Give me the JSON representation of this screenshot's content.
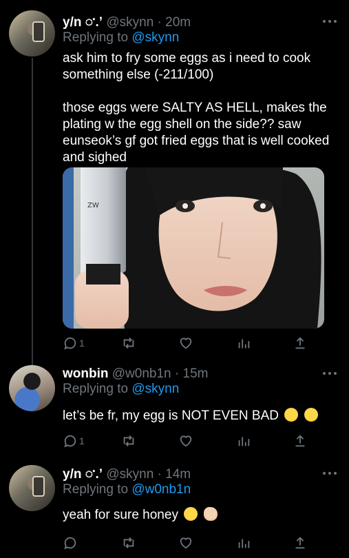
{
  "tweets": [
    {
      "display_name": "y/n 𑀀.’",
      "handle": "@skynn",
      "sep": "·",
      "time": "20m",
      "replying_prefix": "Replying to",
      "replying_to": "@skynn",
      "text_paragraphs": [
        "ask him to fry some eggs as i need to cook something else (-211/100)",
        "those eggs were SALTY AS HELL, makes the plating w the egg shell on the side?? saw eunseok’s gf got fried eggs that is well cooked and sighed"
      ],
      "reply_count": "1"
    },
    {
      "display_name": "wonbin",
      "handle": "@w0nb1n",
      "sep": "·",
      "time": "15m",
      "replying_prefix": "Replying to",
      "replying_to": "@skynn",
      "text": "let’s be fr, my egg is NOT EVEN BAD",
      "emojis": [
        "face-with-steam-icon",
        "face-with-steam-icon"
      ],
      "reply_count": "1"
    },
    {
      "display_name": "y/n 𑀀.’",
      "handle": "@skynn",
      "sep": "·",
      "time": "14m",
      "replying_prefix": "Replying to",
      "replying_to": "@w0nb1n",
      "text": "yeah for sure honey",
      "emojis": [
        "smirking-face-icon",
        "thumbs-up-icon"
      ],
      "reply_count": ""
    }
  ],
  "colors": {
    "background": "#000000",
    "text": "#e7e9ea",
    "muted": "#6e767d",
    "link": "#1d9bf0",
    "thread_line": "#333639"
  }
}
